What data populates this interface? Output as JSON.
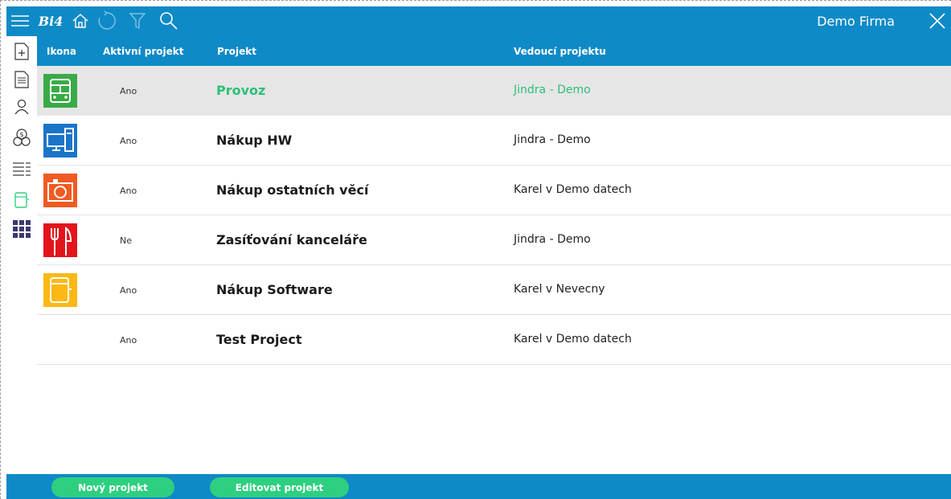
{
  "header": {
    "logo_text": "Bi4",
    "company": "Demo Firma"
  },
  "table": {
    "columns": {
      "icon": "Ikona",
      "active": "Aktivní projekt",
      "project": "Projekt",
      "lead": "Vedoucí projektu"
    },
    "rows": [
      {
        "icon": "bus-icon",
        "icon_color": "#3aaa47",
        "active": "Ano",
        "project": "Provoz",
        "lead": "Jindra - Demo",
        "selected": true
      },
      {
        "icon": "computer-icon",
        "icon_color": "#1a75c9",
        "active": "Ano",
        "project": "Nákup HW",
        "lead": "Jindra - Demo"
      },
      {
        "icon": "camera-icon",
        "icon_color": "#f05a22",
        "active": "Ano",
        "project": "Nákup ostatních věcí",
        "lead": "Karel v Demo datech"
      },
      {
        "icon": "cutlery-icon",
        "icon_color": "#e3141b",
        "active": "Ne",
        "project": "Zasíťování kanceláře",
        "lead": "Jindra - Demo"
      },
      {
        "icon": "notebook-icon",
        "icon_color": "#fdb813",
        "active": "Ano",
        "project": "Nákup Software",
        "lead": "Karel v Nevecny"
      },
      {
        "icon": "",
        "icon_color": "",
        "active": "Ano",
        "project": "Test Project",
        "lead": "Karel v Demo datech"
      }
    ]
  },
  "footer": {
    "new_project": "Nový projekt",
    "edit_project": "Editovat projekt"
  },
  "colors": {
    "bar": "#0e8ac6",
    "accent_green": "#2ecf7f",
    "selected_text": "#2dbf7a"
  }
}
